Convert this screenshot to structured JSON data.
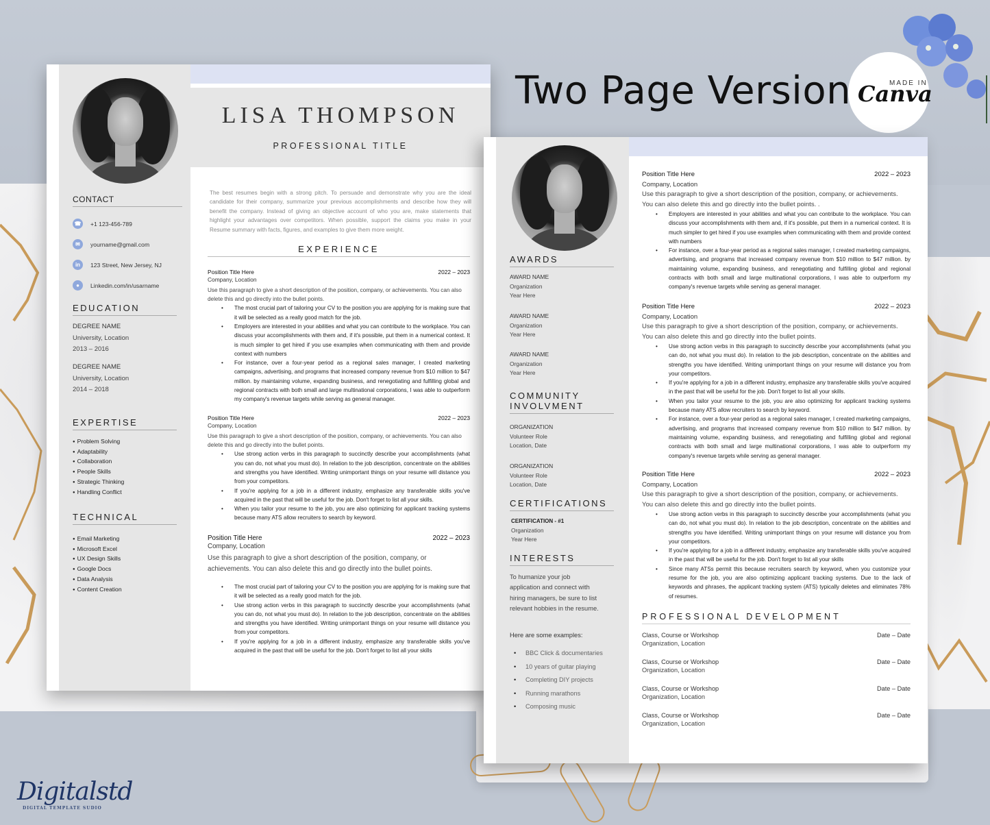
{
  "headline": "Two Page Version",
  "badge": {
    "made_in": "MADE IN",
    "brand": "Canva"
  },
  "watermark": {
    "script": "Digitalstd",
    "subtitle": "DIGITAL TEMPLATE SUDIO"
  },
  "colors": {
    "accent": "#dde2f3",
    "sidebar": "#e6e6e6",
    "icon": "#8fa8dc",
    "background": "#bfc6d1",
    "gold": "#c99b5a"
  },
  "page1": {
    "name": "LISA THOMPSON",
    "title": "PROFESSIONAL TITLE",
    "contact": {
      "heading": "CONTACT",
      "items": [
        {
          "icon": "phone-icon",
          "glyph": "☎",
          "text": "+1 123-456-789"
        },
        {
          "icon": "email-icon",
          "glyph": "✉",
          "text": "yourname@gmail.com"
        },
        {
          "icon": "linkedin-icon",
          "glyph": "in",
          "text": "123 Street, New Jersey,  NJ"
        },
        {
          "icon": "location-icon",
          "glyph": "●",
          "text": "Linkedin.com/in/usarname"
        }
      ]
    },
    "education": {
      "heading": "EDUCATION",
      "items": [
        {
          "degree": "DEGREE NAME",
          "school": "University, Location",
          "years": "2013 – 2016"
        },
        {
          "degree": "DEGREE NAME",
          "school": "University, Location",
          "years": "2014 – 2018"
        }
      ]
    },
    "expertise": {
      "heading": "EXPERTISE",
      "items": [
        "Problem Solving",
        "Adaptability",
        "Collaboration",
        "People Skills",
        "Strategic Thinking",
        "Handling Conflict"
      ]
    },
    "technical": {
      "heading": "TECHNICAL",
      "items": [
        "Email Marketing",
        "Microsoft Excel",
        "UX Design Skills",
        "Google Docs",
        "Data Analysis",
        "Content Creation"
      ]
    },
    "summary": "The best resumes begin with a strong pitch. To persuade and demonstrate why you are the ideal candidate for their company, summarize your previous accomplishments and describe how they will benefit the company. Instead of giving an objective account of who you are, make statements that highlight your advantages over competitors. When possible, support the claims you make in your Resume summary with facts, figures, and examples to give them more weight.",
    "experience_heading": "EXPERIENCE",
    "jobs": [
      {
        "title": "Position Title Here",
        "dates": "2022 – 2023",
        "company": "Company, Location",
        "desc": "Use this paragraph to give a short description of the position, company, or achievements. You can also delete this and go directly into the bullet points.",
        "bullets": [
          "The most crucial part of tailoring your CV to the position you are applying for is making sure that it will be selected as a really good match for the job.",
          "Employers are interested in your abilities and what you can contribute to the workplace. You can discuss your accomplishments with them and, if it's possible, put them in a numerical context. It is much simpler to get hired if you use examples when communicating with them and provide context with numbers",
          "For instance, over a four-year period as a regional sales manager, I created marketing campaigns, advertising, and programs that increased company revenue from $10 million to $47 million. by maintaining volume, expanding business, and renegotiating and fulfilling global and regional contracts with both small and large multinational corporations, I was able to outperform my company's revenue targets while serving as general manager."
        ]
      },
      {
        "title": "Position Title Here",
        "dates": "2022 – 2023",
        "company": "Company, Location",
        "desc": "Use this paragraph to give a short description of the position, company, or achievements. You can also delete this and go directly into the bullet points.",
        "bullets": [
          "Use strong action verbs in this paragraph to succinctly describe your accomplishments (what you can do, not what you must do). In relation to the job description, concentrate on the abilities and strengths you have identified. Writing unimportant things on your resume will distance you from your competitors.",
          "If you're applying for a job in a different industry, emphasize any transferable skills you've acquired in the past that will be useful for the job. Don't forget to list all your skills.",
          "When you tailor your resume to the job, you are also optimizing for applicant tracking systems because many ATS allow recruiters to search by keyword."
        ]
      },
      {
        "title": "Position Title Here",
        "dates": "2022 – 2023",
        "company": "Company, Location",
        "desc": "Use this paragraph to give a short description of the position, company, or achievements. You can also delete this and go directly into the bullet points.",
        "bullets": [
          "The most crucial part of tailoring your CV to the position you are applying for is making sure that it will be selected as a really good match for the job.",
          "Use strong action verbs in this paragraph to succinctly describe your accomplishments (what you can do, not what you must do). In relation to the job description, concentrate on the abilities and strengths you have identified. Writing unimportant things on your resume will distance you from your competitors.",
          "If you're applying for a job in a different industry, emphasize any transferable skills you've acquired in the past that will be useful for the job. Don't forget to list all your skills"
        ]
      }
    ]
  },
  "page2": {
    "awards": {
      "heading": "AWARDS",
      "items": [
        {
          "name": "AWARD NAME",
          "org": "Organization",
          "year": "Year Here"
        },
        {
          "name": "AWARD NAME",
          "org": "Organization",
          "year": "Year Here"
        },
        {
          "name": "AWARD NAME",
          "org": "Organization",
          "year": "Year Here"
        }
      ]
    },
    "community": {
      "heading_line1": "COMMUNITY",
      "heading_line2": "INVOLVMENT",
      "items": [
        {
          "org": "ORGANIZATION",
          "role": "Volunteer Role",
          "loc": "Location, Date"
        },
        {
          "org": "ORGANIZATION",
          "role": "Volunteer Role",
          "loc": "Location, Date"
        }
      ]
    },
    "certifications": {
      "heading": "CERTIFICATIONS",
      "items": [
        {
          "name": "CERTIFICATION - #1",
          "org": "Organization",
          "year": "Year Here"
        }
      ]
    },
    "interests": {
      "heading": "INTERESTS",
      "intro": "To humanize your job application and connect with hiring managers, be sure to list relevant hobbies in the resume.",
      "examples_label": "Here are some examples:",
      "items": [
        "BBC Click & documentaries",
        "10 years of guitar playing",
        "Completing DIY projects",
        "Running marathons",
        "Composing music"
      ]
    },
    "jobs": [
      {
        "title": "Position Title Here",
        "dates": "2022 – 2023",
        "company": "Company, Location",
        "desc": "Use this paragraph to give a short description of the position, company, or achievements. You can also delete this and go directly into the bullet points. .",
        "bullets": [
          "Employers are interested in your abilities and what you can contribute to the workplace. You can discuss your accomplishments with them and, if it's possible, put them in a numerical context. It is much simpler to get hired if you use examples when communicating with them and provide context with numbers",
          "For instance, over a four-year period as a regional sales manager, I created marketing campaigns, advertising, and programs that increased company revenue from $10 million to $47 million. by maintaining volume, expanding business, and renegotiating and fulfilling global and regional contracts with both small and large multinational corporations, I was able to outperform my company's revenue targets while serving as general manager."
        ]
      },
      {
        "title": "Position Title Here",
        "dates": "2022 – 2023",
        "company": "Company, Location",
        "desc": "Use this paragraph to give a short description of the position, company, or achievements. You can also delete this and go directly into the bullet points.",
        "bullets": [
          "Use strong action verbs in this paragraph to succinctly describe your accomplishments (what you can do, not what you must do). In relation to the job description, concentrate on the abilities and strengths you have identified. Writing unimportant things on your resume will distance you from your competitors.",
          "If you're applying for a job in a different industry, emphasize any transferable skills you've acquired in the past that will be useful for the job. Don't forget to list all your skills.",
          "When you tailor your resume to the job, you are also optimizing for applicant tracking systems because many ATS allow recruiters to search by keyword.",
          "For instance, over a four-year period as a regional sales manager, I created marketing campaigns, advertising, and programs that increased company revenue from $10 million to $47 million. by maintaining volume, expanding business, and renegotiating and fulfilling global and regional contracts with both small and large multinational corporations, I was able to outperform my company's revenue targets while serving as general manager."
        ]
      },
      {
        "title": "Position Title Here",
        "dates": "2022 – 2023",
        "company": "Company, Location",
        "desc": "Use this paragraph to give a short description of the position, company, or achievements. You can also delete this and go directly into the bullet points.",
        "bullets": [
          "Use strong action verbs in this paragraph to succinctly describe your accomplishments (what you can do, not what you must do). In relation to the job description, concentrate on the abilities and strengths you have identified. Writing unimportant things on your resume will distance you from your competitors.",
          "If you're applying for a job in a different industry, emphasize any transferable skills you've acquired in the past that will be useful for the job. Don't forget to list all your skills",
          "Since many ATSs permit this because recruiters search by keyword, when you customize your resume for the job, you are also optimizing applicant tracking systems. Due to the lack of keywords and phrases, the applicant tracking system (ATS) typically deletes and eliminates 78% of resumes."
        ]
      }
    ],
    "professional_development": {
      "heading": "PROFESSIONAL DEVELOPMENT",
      "items": [
        {
          "name": "Class, Course or Workshop",
          "dates": "Date – Date",
          "org": "Organization, Location"
        },
        {
          "name": "Class, Course or Workshop",
          "dates": "Date – Date",
          "org": "Organization, Location"
        },
        {
          "name": "Class, Course or Workshop",
          "dates": "Date – Date",
          "org": "Organization, Location"
        },
        {
          "name": "Class, Course or Workshop",
          "dates": "Date – Date",
          "org": "Organization, Location"
        }
      ]
    }
  }
}
